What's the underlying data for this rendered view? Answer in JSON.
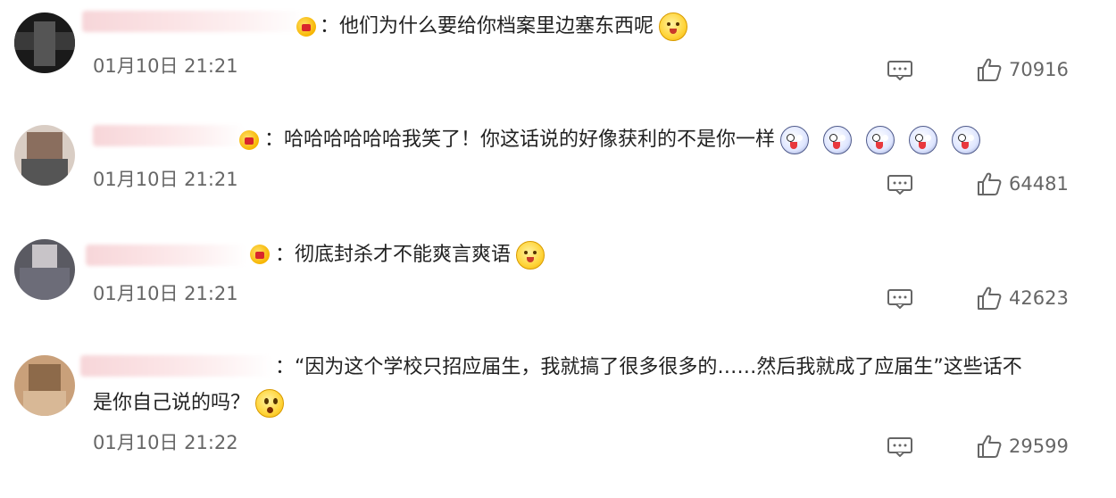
{
  "comments": [
    {
      "text": "：他们为什么要给你档案里边塞东西呢",
      "emojis": [
        "smile"
      ],
      "time": "01月10日 21:21",
      "likes": "70916"
    },
    {
      "text": "：哈哈哈哈哈哈我笑了！你这话说的好像获利的不是你一样",
      "emojis": [
        "ghost",
        "ghost",
        "ghost",
        "ghost",
        "ghost"
      ],
      "time": "01月10日 21:21",
      "likes": "64481"
    },
    {
      "text": "：彻底封杀才不能爽言爽语",
      "emojis": [
        "smile"
      ],
      "time": "01月10日 21:21",
      "likes": "42623"
    },
    {
      "text": "：“因为这个学校只招应届生，我就搞了很多很多的……然后我就成了应届生”这些话不是你自己说的吗？",
      "line1": "：“因为这个学校只招应届生，我就搞了很多很多的……然后我就成了应届生”这些话不",
      "line2": "是你自己说的吗？",
      "emojis": [
        "shock"
      ],
      "time": "01月10日 21:22",
      "likes": "29599"
    }
  ],
  "icons": {
    "reply": "comment-icon",
    "like": "thumbs-up-icon"
  },
  "colors": {
    "text": "#222222",
    "meta": "#666666",
    "badge": "#f7b500"
  }
}
